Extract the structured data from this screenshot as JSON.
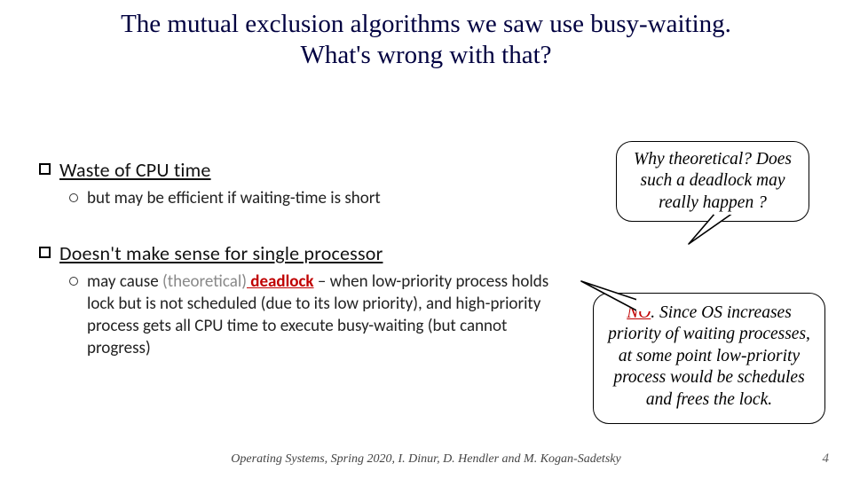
{
  "title": "The mutual exclusion algorithms we saw use busy-waiting.\nWhat's wrong with that?",
  "bullets": [
    {
      "heading": "Waste of CPU time",
      "sub": "but may be efficient if waiting-time is short"
    },
    {
      "heading": "Doesn't make sense for single processor",
      "sub_pre": "may cause ",
      "sub_gray": "(theoretical)",
      "sub_deadlock": " deadlock",
      "sub_post": " – when low-priority process holds lock but is not scheduled (due to its low priority), and high-priority process gets all CPU time to execute busy-waiting (but cannot progress)"
    }
  ],
  "callout1": "Why theoretical? Does such a deadlock may really happen ?",
  "callout2_no": "NO",
  "callout2_rest": ". Since OS increases priority of waiting processes, at some point low-priority process would be schedules and frees the lock.",
  "footer": "Operating Systems, Spring 2020, I. Dinur, D. Hendler and M. Kogan-Sadetsky",
  "page": "4"
}
